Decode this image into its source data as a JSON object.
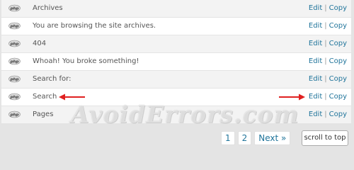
{
  "templates": [
    {
      "label": "Archives",
      "edit": "Edit",
      "separator": "|",
      "copy": "Copy"
    },
    {
      "label": "You are browsing the site archives.",
      "edit": "Edit",
      "separator": "|",
      "copy": "Copy"
    },
    {
      "label": "404",
      "edit": "Edit",
      "separator": "|",
      "copy": "Copy"
    },
    {
      "label": "Whoah! You broke something!",
      "edit": "Edit",
      "separator": "|",
      "copy": "Copy"
    },
    {
      "label": "Search for:",
      "edit": "Edit",
      "separator": "|",
      "copy": "Copy"
    },
    {
      "label": "Search",
      "edit": "Edit",
      "separator": "|",
      "copy": "Copy"
    },
    {
      "label": "Pages",
      "edit": "Edit",
      "separator": "|",
      "copy": "Copy"
    }
  ],
  "icon": "php-file-icon",
  "icon_text": "php",
  "pagination": {
    "page1": "1",
    "page2": "2",
    "next": "Next »"
  },
  "scroll_top_label": "scroll to top",
  "watermark": "AvoidErrors.com",
  "colors": {
    "link": "#21759b",
    "arrow": "#e02020",
    "row_odd": "#f3f3f3",
    "row_even": "#ffffff",
    "page_bg": "#e4e4e4"
  }
}
